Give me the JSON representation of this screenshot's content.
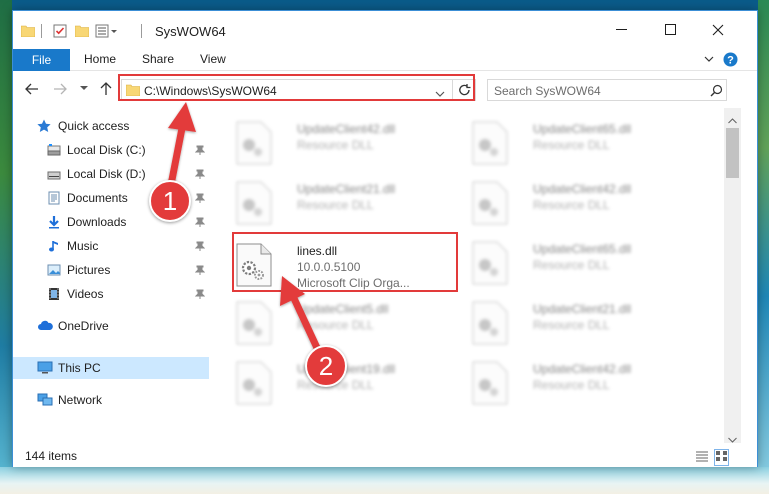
{
  "window": {
    "title": "SysWOW64"
  },
  "ribbon": {
    "tabs": [
      "File",
      "Home",
      "Share",
      "View"
    ]
  },
  "address": {
    "path": "C:\\Windows\\SysWOW64"
  },
  "search": {
    "placeholder": "Search SysWOW64"
  },
  "nav": {
    "quick_access": "Quick access",
    "items": [
      {
        "label": "Local Disk (C:)",
        "icon": "drive-icon"
      },
      {
        "label": "Local Disk (D:)",
        "icon": "drive-icon"
      },
      {
        "label": "Documents",
        "icon": "documents-icon"
      },
      {
        "label": "Downloads",
        "icon": "downloads-icon"
      },
      {
        "label": "Music",
        "icon": "music-icon"
      },
      {
        "label": "Pictures",
        "icon": "pictures-icon"
      },
      {
        "label": "Videos",
        "icon": "videos-icon"
      }
    ],
    "onedrive": "OneDrive",
    "this_pc": "This PC",
    "network": "Network"
  },
  "files": [
    {
      "name": "UpdateClient42.dll",
      "desc": "Resource DLL"
    },
    {
      "name": "UpdateClient65.dll",
      "desc": "Resource DLL"
    },
    {
      "name": "UpdateClient21.dll",
      "desc": "Resource DLL"
    },
    {
      "name": "UpdateClient42.dll",
      "desc": "Resource DLL"
    },
    {
      "name": "lines.dll",
      "desc": "10.0.0.5100",
      "desc2": "Microsoft Clip Orga..."
    },
    {
      "name": "UpdateClient65.dll",
      "desc": "Resource DLL"
    },
    {
      "name": "UpdateClient5.dll",
      "desc": "Resource DLL"
    },
    {
      "name": "UpdateClient21.dll",
      "desc": "Resource DLL"
    },
    {
      "name": "UpdateClient19.dll",
      "desc": "Resource DLL"
    },
    {
      "name": "UpdateClient42.dll",
      "desc": "Resource DLL"
    }
  ],
  "status": {
    "item_count": "144 items"
  },
  "callouts": {
    "one": "1",
    "two": "2"
  },
  "colors": {
    "accent": "#1979ca",
    "annotation": "#e23a3a",
    "selected": "#cce8ff"
  }
}
